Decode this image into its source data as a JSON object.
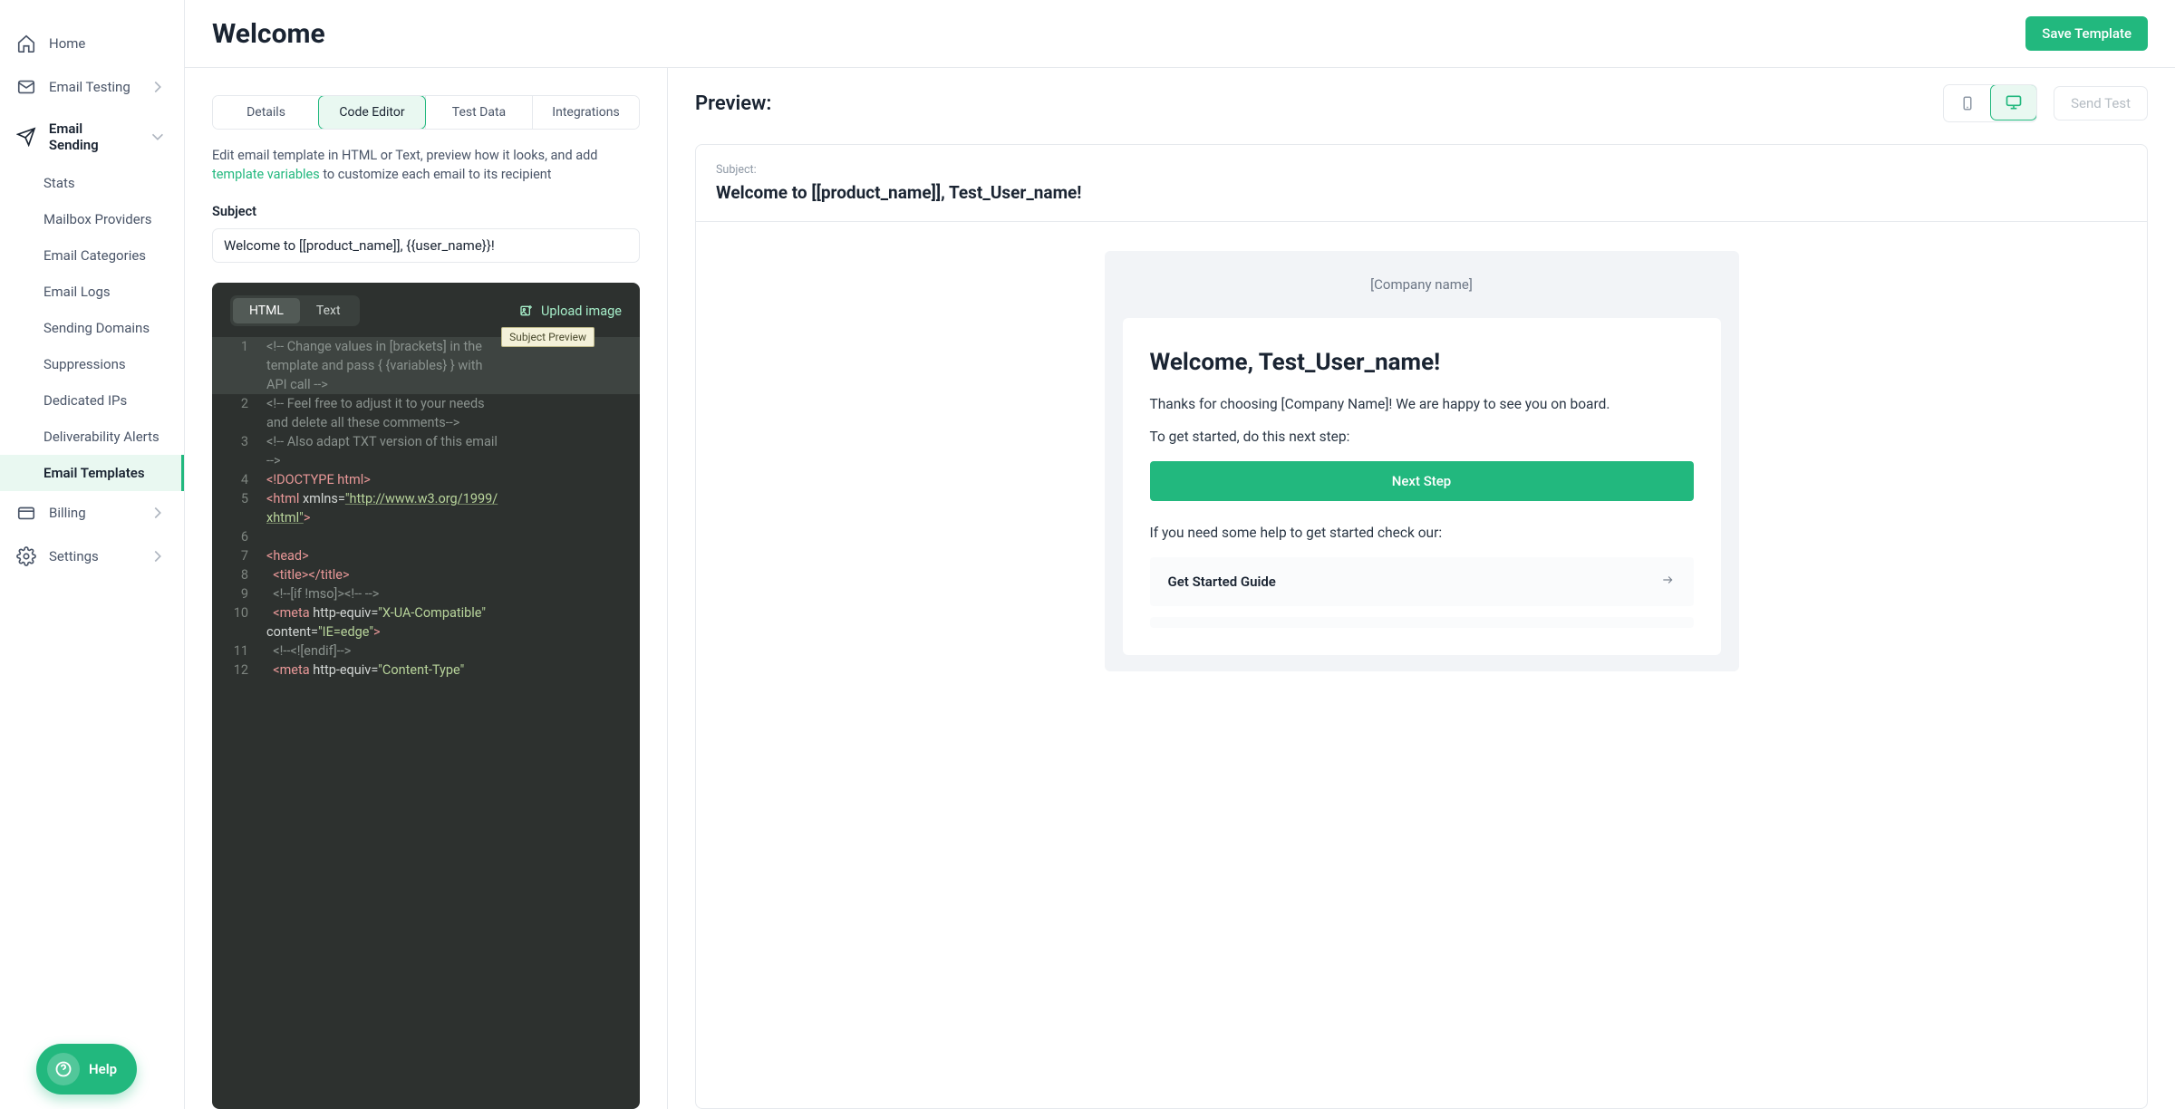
{
  "page_title": "Welcome",
  "save_button": "Save Template",
  "sidebar": {
    "items": [
      {
        "label": "Home",
        "icon": "home"
      },
      {
        "label": "Email Testing",
        "icon": "mail-check",
        "expandable": true
      },
      {
        "label": "Email Sending",
        "icon": "send",
        "expandable": true,
        "expanded": true
      },
      {
        "label": "Billing",
        "icon": "card",
        "expandable": true
      },
      {
        "label": "Settings",
        "icon": "gear",
        "expandable": true
      }
    ],
    "sending_children": [
      "Stats",
      "Mailbox Providers",
      "Email Categories",
      "Email Logs",
      "Sending Domains",
      "Suppressions",
      "Dedicated IPs",
      "Deliverability Alerts",
      "Email Templates"
    ],
    "active_child_index": 8,
    "help_label": "Help"
  },
  "editor": {
    "tabs": [
      "Details",
      "Code Editor",
      "Test Data",
      "Integrations"
    ],
    "active_tab_index": 1,
    "hint_pre": "Edit email template in HTML or Text, preview how it looks, and add ",
    "hint_link": "template variables",
    "hint_post": " to customize each email to its recipient",
    "subject_label": "Subject",
    "subject_value": "Welcome to [[product_name]], {{user_name}}!",
    "code_tabs": [
      "HTML",
      "Text"
    ],
    "code_active_index": 0,
    "upload_label": "Upload image",
    "tooltip": "Subject Preview",
    "code_lines": [
      {
        "n": 1,
        "hi": true,
        "segs": [
          {
            "cls": "c-cmt",
            "t": "<!-- Change values in [brackets] in the "
          }
        ]
      },
      {
        "n": "",
        "hi": true,
        "segs": [
          {
            "cls": "c-cmt",
            "t": "template and pass { {variables} } with "
          }
        ]
      },
      {
        "n": "",
        "hi": true,
        "segs": [
          {
            "cls": "c-cmt",
            "t": "API call -->"
          }
        ]
      },
      {
        "n": 2,
        "segs": [
          {
            "cls": "c-cmt",
            "t": "<!-- Feel free to adjust it to your needs "
          }
        ]
      },
      {
        "n": "",
        "segs": [
          {
            "cls": "c-cmt",
            "t": "and delete all these comments-->"
          }
        ]
      },
      {
        "n": 3,
        "segs": [
          {
            "cls": "c-cmt",
            "t": "<!-- Also adapt TXT version of this email "
          }
        ]
      },
      {
        "n": "",
        "segs": [
          {
            "cls": "c-cmt",
            "t": "-->"
          }
        ]
      },
      {
        "n": 4,
        "segs": [
          {
            "cls": "c-tag",
            "t": "<!DOCTYPE html>"
          }
        ]
      },
      {
        "n": 5,
        "segs": [
          {
            "cls": "c-tag",
            "t": "<html "
          },
          {
            "cls": "c-punc",
            "t": "xmlns="
          },
          {
            "cls": "c-str",
            "t": "\"http://www.w3.org/1999/"
          }
        ]
      },
      {
        "n": "",
        "segs": [
          {
            "cls": "c-str",
            "t": "xhtml\""
          },
          {
            "cls": "c-tag",
            "t": ">"
          }
        ]
      },
      {
        "n": 6,
        "segs": [
          {
            "cls": "c-punc",
            "t": ""
          }
        ]
      },
      {
        "n": 7,
        "segs": [
          {
            "cls": "c-tag",
            "t": "<head>"
          }
        ]
      },
      {
        "n": 8,
        "segs": [
          {
            "cls": "c-punc",
            "t": "  "
          },
          {
            "cls": "c-tag",
            "t": "<title></title>"
          }
        ]
      },
      {
        "n": 9,
        "segs": [
          {
            "cls": "c-punc",
            "t": "  "
          },
          {
            "cls": "c-cmt",
            "t": "<!--[if !mso]><!-- -->"
          }
        ]
      },
      {
        "n": 10,
        "segs": [
          {
            "cls": "c-punc",
            "t": "  "
          },
          {
            "cls": "c-tag",
            "t": "<meta "
          },
          {
            "cls": "c-punc",
            "t": "http-equiv="
          },
          {
            "cls": "c-str plain",
            "t": "\"X-UA-Compatible\" "
          }
        ]
      },
      {
        "n": "",
        "segs": [
          {
            "cls": "c-punc",
            "t": "content="
          },
          {
            "cls": "c-str plain",
            "t": "\"IE=edge\""
          },
          {
            "cls": "c-tag",
            "t": ">"
          }
        ]
      },
      {
        "n": 11,
        "segs": [
          {
            "cls": "c-punc",
            "t": "  "
          },
          {
            "cls": "c-cmt",
            "t": "<!--<![endif]-->"
          }
        ]
      },
      {
        "n": 12,
        "segs": [
          {
            "cls": "c-punc",
            "t": "  "
          },
          {
            "cls": "c-tag",
            "t": "<meta "
          },
          {
            "cls": "c-punc",
            "t": "http-equiv="
          },
          {
            "cls": "c-str plain",
            "t": "\"Content-Type\" "
          }
        ]
      }
    ]
  },
  "preview": {
    "heading": "Preview:",
    "send_test": "Send Test",
    "subject_label": "Subject:",
    "subject_rendered": "Welcome to [[product_name]], Test_User_name!",
    "logo": "[Company name]",
    "welcome_heading": "Welcome, Test_User_name!",
    "p1": "Thanks for choosing [Company Name]! We are happy to see you on board.",
    "p2": "To get started, do this next step:",
    "cta": "Next Step",
    "p3": "If you need some help to get started check our:",
    "guide_label": "Get Started Guide"
  }
}
